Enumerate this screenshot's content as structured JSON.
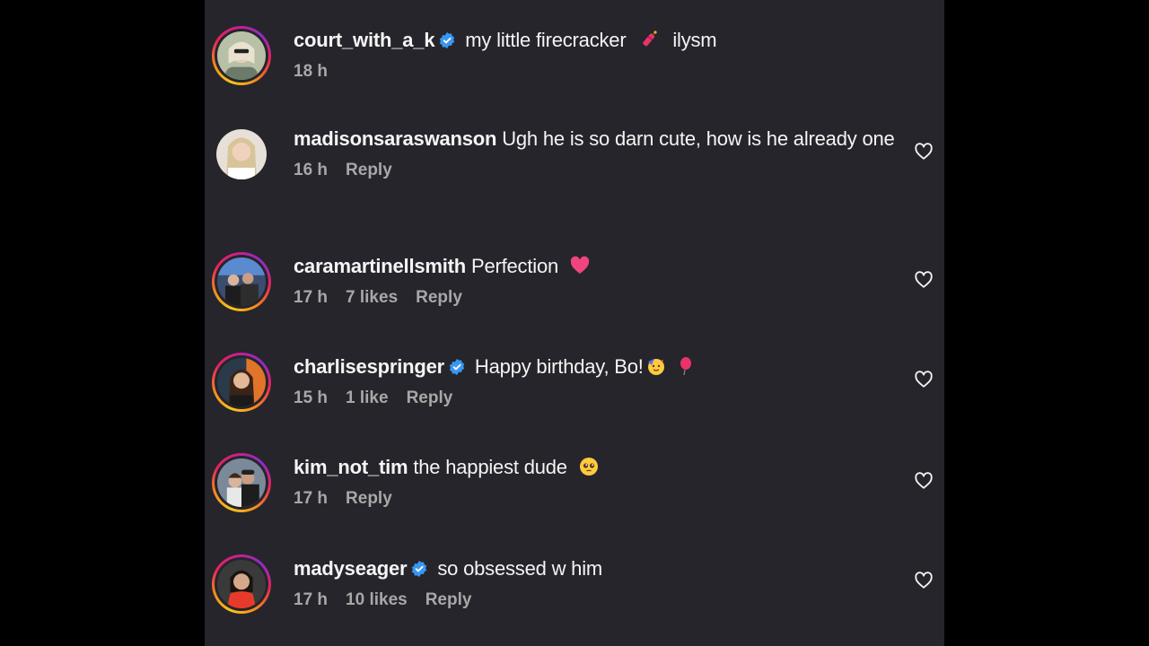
{
  "comments": [
    {
      "username": "court_with_a_k",
      "verified": true,
      "text_before": "my little firecracker",
      "emoji": "firecracker",
      "text_after": "ilysm",
      "time": "18 h",
      "likes": "",
      "reply": "",
      "has_heart": false,
      "has_ring": true
    },
    {
      "username": "madisonsaraswanson",
      "verified": false,
      "text_before": "Ugh he is so darn cute, how is he already one",
      "emoji": "",
      "text_after": "",
      "time": "16 h",
      "likes": "",
      "reply": "Reply",
      "has_heart": true,
      "has_ring": false
    },
    {
      "username": "caramartinellsmith",
      "verified": false,
      "text_before": "Perfection",
      "emoji": "pink-heart",
      "text_after": "",
      "time": "17 h",
      "likes": "7 likes",
      "reply": "Reply",
      "has_heart": true,
      "has_ring": true
    },
    {
      "username": "charlisespringer",
      "verified": true,
      "text_before": "Happy birthday, Bo!",
      "emoji": "party-face-balloon",
      "text_after": "",
      "time": "15 h",
      "likes": "1 like",
      "reply": "Reply",
      "has_heart": true,
      "has_ring": true
    },
    {
      "username": "kim_not_tim",
      "verified": false,
      "text_before": "the happiest dude",
      "emoji": "pleading-face",
      "text_after": "",
      "time": "17 h",
      "likes": "",
      "reply": "Reply",
      "has_heart": true,
      "has_ring": true
    },
    {
      "username": "madyseager",
      "verified": true,
      "text_before": "so obsessed w him",
      "emoji": "",
      "text_after": "",
      "time": "17 h",
      "likes": "10 likes",
      "reply": "Reply",
      "has_heart": true,
      "has_ring": true
    }
  ],
  "colors": {
    "background": "#000000",
    "panel": "#25252b",
    "text": "#f5f5f5",
    "meta": "#a8a8a8",
    "verified": "#3897f0"
  },
  "icons": [
    "verified-badge-icon",
    "heart-outline-icon"
  ]
}
